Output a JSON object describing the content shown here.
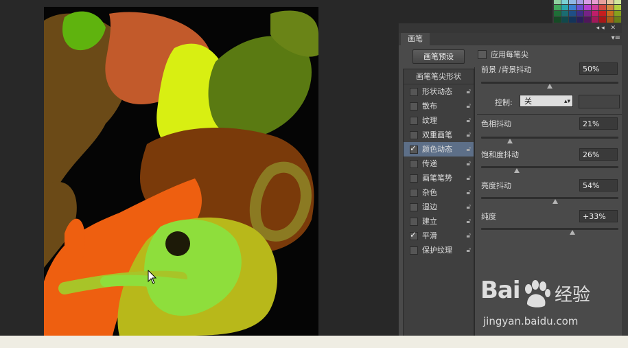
{
  "panel": {
    "tab_label": "画笔",
    "top_controls": "◂◂ ✕",
    "menu_icon": "▾≡",
    "preset_button": "画笔预设",
    "apply_per_tip": "应用每笔尖",
    "list_title": "画笔笔尖形状",
    "items": [
      {
        "label": "形状动态",
        "checked": false,
        "selected": false
      },
      {
        "label": "散布",
        "checked": false,
        "selected": false
      },
      {
        "label": "纹理",
        "checked": false,
        "selected": false
      },
      {
        "label": "双重画笔",
        "checked": false,
        "selected": false
      },
      {
        "label": "颜色动态",
        "checked": true,
        "selected": true
      },
      {
        "label": "传递",
        "checked": false,
        "selected": false
      },
      {
        "label": "画笔笔势",
        "checked": false,
        "selected": false
      },
      {
        "label": "杂色",
        "checked": false,
        "selected": false
      },
      {
        "label": "湿边",
        "checked": false,
        "selected": false
      },
      {
        "label": "建立",
        "checked": false,
        "selected": false
      },
      {
        "label": "平滑",
        "checked": true,
        "selected": false
      },
      {
        "label": "保护纹理",
        "checked": false,
        "selected": false
      }
    ],
    "fg_bg_jitter": {
      "label": "前景 /背景抖动",
      "value": "50%",
      "level": 0.5
    },
    "control": {
      "label": "控制:",
      "value": "关"
    },
    "hue_jitter": {
      "label": "色相抖动",
      "value": "21%",
      "level": 0.21
    },
    "saturation_jitter": {
      "label": "饱和度抖动",
      "value": "26%",
      "level": 0.26
    },
    "brightness_jitter": {
      "label": "亮度抖动",
      "value": "54%",
      "level": 0.54
    },
    "purity": {
      "label": "纯度",
      "value": "+33%",
      "level": 0.665
    }
  },
  "watermark": {
    "brand": "Bai",
    "brand_suffix": "经验",
    "url": "jingyan.baidu.com"
  },
  "icons": {
    "lock": "lock-icon",
    "check": "checkmark-icon",
    "dropdown": "updown-arrow-icon",
    "cursor": "arrow-cursor-icon"
  },
  "colors": {
    "panel_bg": "#4a4a4a",
    "selected_row": "#5d6f88",
    "workspace": "#282828"
  }
}
